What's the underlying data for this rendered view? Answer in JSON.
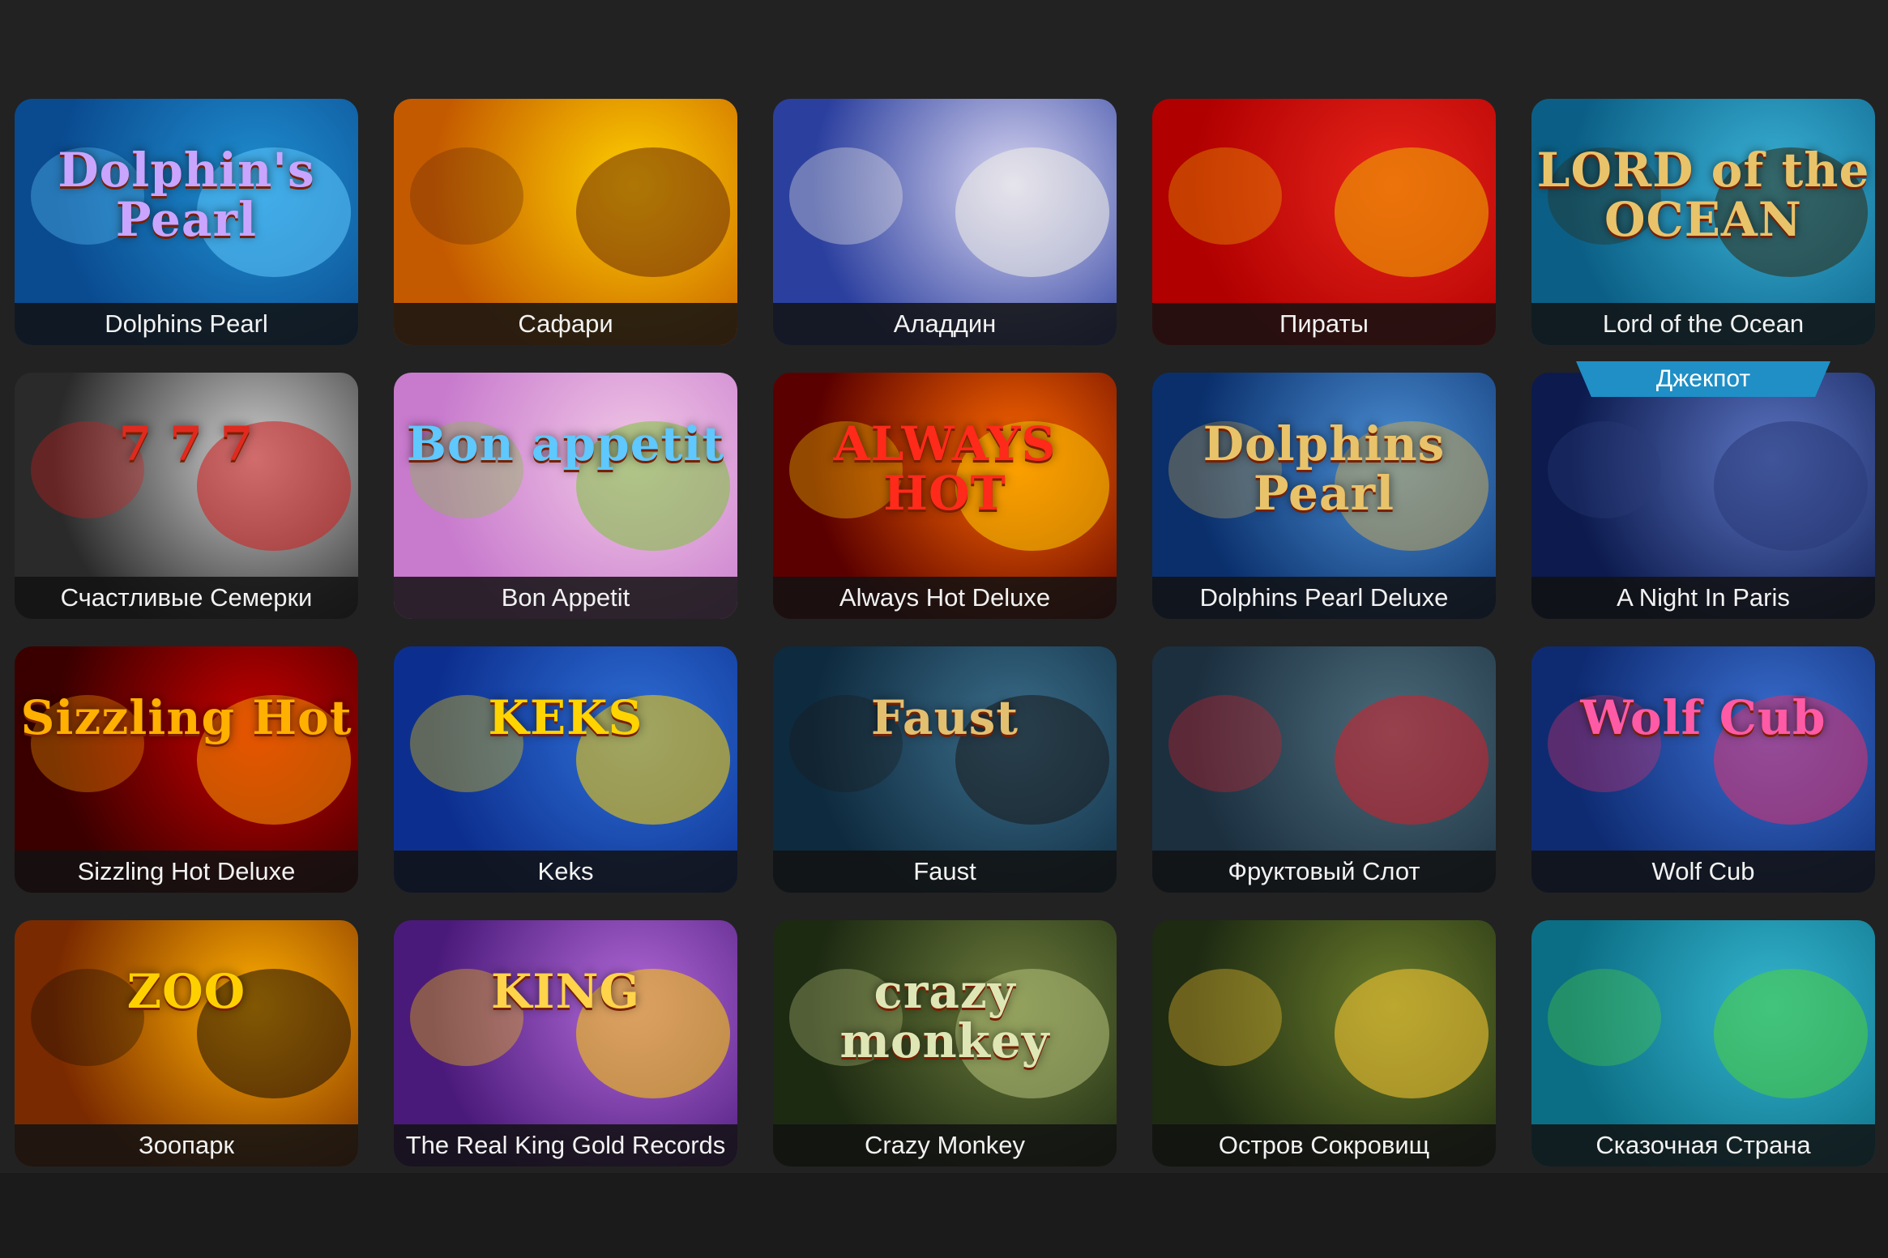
{
  "games": [
    {
      "title": "Dolphins Pearl",
      "art_text": "Dolphin's Pearl",
      "bg": [
        "#0a4a8f",
        "#1f8fd0"
      ],
      "accent": "#5ec8ff",
      "art_color": "#c9a5ff"
    },
    {
      "title": "Сафари",
      "art_text": "",
      "bg": [
        "#c45a00",
        "#ffd000"
      ],
      "accent": "#6b2d0a",
      "art_color": "#ffd34a"
    },
    {
      "title": "Аладдин",
      "art_text": "",
      "bg": [
        "#2b3f9e",
        "#d9d6f2"
      ],
      "accent": "#f1efe6",
      "art_color": "#ffd34a"
    },
    {
      "title": "Пираты",
      "art_text": "",
      "bg": [
        "#b00000",
        "#e8241b"
      ],
      "accent": "#f0b400",
      "art_color": "#ffd34a"
    },
    {
      "title": "Lord of the Ocean",
      "art_text": "LORD of the OCEAN",
      "bg": [
        "#0b5f86",
        "#3ab2d6"
      ],
      "accent": "#2f2a12",
      "art_color": "#e9c36a"
    },
    {
      "title": "Счастливые Семерки",
      "art_text": "7 7 7",
      "bg": [
        "#2a2a2a",
        "#cfcfcf"
      ],
      "accent": "#d31c1c",
      "art_color": "#e02a1f"
    },
    {
      "title": "Bon Appetit",
      "art_text": "Bon appetit",
      "bg": [
        "#c87acd",
        "#f1c8e6"
      ],
      "accent": "#7cc33b",
      "art_color": "#5ec8ff"
    },
    {
      "title": "Always Hot Deluxe",
      "art_text": "ALWAYS HOT",
      "bg": [
        "#5b0000",
        "#ff6a00"
      ],
      "accent": "#ffd000",
      "art_color": "#ff2a1a"
    },
    {
      "title": "Dolphins Pearl Deluxe",
      "art_text": "Dolphins Pearl",
      "bg": [
        "#0a2f6b",
        "#4b8fd4"
      ],
      "accent": "#c5a85a",
      "art_color": "#e9c36a"
    },
    {
      "title": "A Night In Paris",
      "art_text": "",
      "bg": [
        "#0c1a4d",
        "#5b74c2"
      ],
      "accent": "#2a3b78",
      "art_color": "#ffd34a"
    },
    {
      "title": "Sizzling Hot Deluxe",
      "art_text": "Sizzling Hot",
      "bg": [
        "#3a0000",
        "#c80000"
      ],
      "accent": "#ff9a00",
      "art_color": "#ffb000"
    },
    {
      "title": "Keks",
      "art_text": "KEKS",
      "bg": [
        "#0c2f8f",
        "#2f6fd6"
      ],
      "accent": "#ffd400",
      "art_color": "#ffd400"
    },
    {
      "title": "Faust",
      "art_text": "Faust",
      "bg": [
        "#0e2a3e",
        "#3b6d8a"
      ],
      "accent": "#1a1a1a",
      "art_color": "#e2c070"
    },
    {
      "title": "Фруктовый Слот",
      "art_text": "",
      "bg": [
        "#1b2f3f",
        "#4c6b7a"
      ],
      "accent": "#d61f2a",
      "art_color": "#ffd34a"
    },
    {
      "title": "Wolf Cub",
      "art_text": "Wolf Cub",
      "bg": [
        "#0e2b72",
        "#3a6fd1"
      ],
      "accent": "#e12f6b",
      "art_color": "#ff5aa5"
    },
    {
      "title": "Зоопарк",
      "art_text": "ZOO",
      "bg": [
        "#7a2a00",
        "#ffb000"
      ],
      "accent": "#1a0f07",
      "art_color": "#ffd000"
    },
    {
      "title": "The Real King Gold Records",
      "art_text": "KING",
      "bg": [
        "#4a1a7a",
        "#b36ad9"
      ],
      "accent": "#ffd000",
      "art_color": "#ffd34a"
    },
    {
      "title": "Crazy Monkey",
      "art_text": "crazy monkey",
      "bg": [
        "#1d2a12",
        "#6a7a3a"
      ],
      "accent": "#b7c27b",
      "art_color": "#dfe6b5"
    },
    {
      "title": "Остров Сокровищ",
      "art_text": "",
      "bg": [
        "#1e2a12",
        "#6a7d2b"
      ],
      "accent": "#ffcc33",
      "art_color": "#ffd34a"
    },
    {
      "title": "Сказочная Страна",
      "art_text": "",
      "bg": [
        "#0b6e85",
        "#35b5cf"
      ],
      "accent": "#4fd23a",
      "art_color": "#ffd34a"
    }
  ],
  "badges": {
    "jackpot_label": "Джекпот"
  }
}
